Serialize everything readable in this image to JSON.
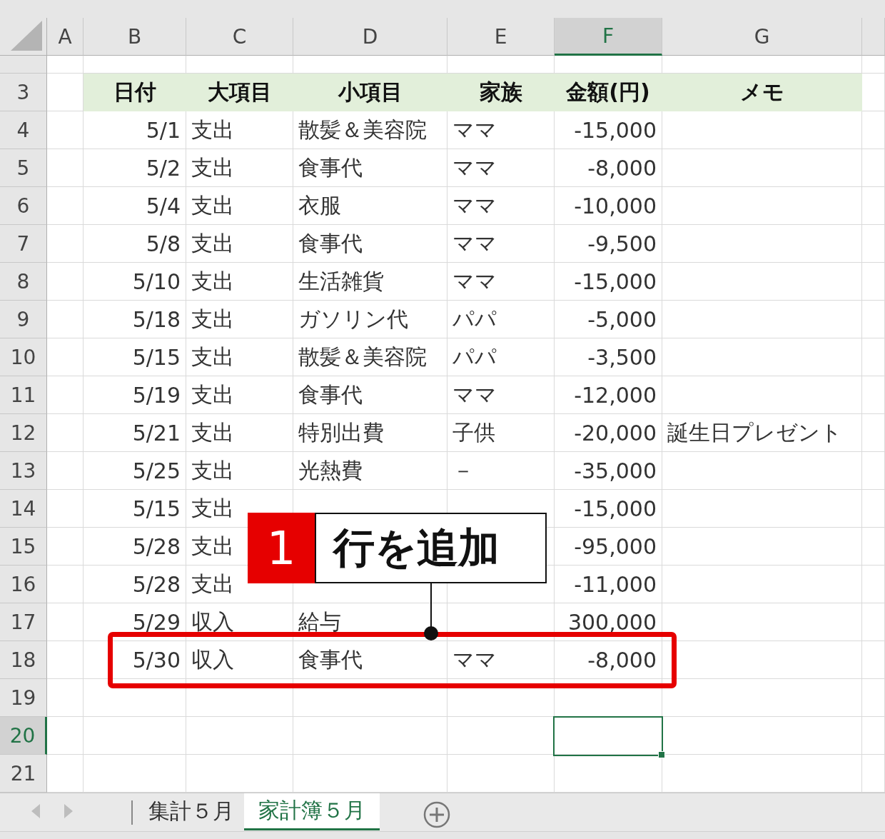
{
  "columns": [
    {
      "label": "A",
      "selected": false
    },
    {
      "label": "B",
      "selected": false
    },
    {
      "label": "C",
      "selected": false
    },
    {
      "label": "D",
      "selected": false
    },
    {
      "label": "E",
      "selected": false
    },
    {
      "label": "F",
      "selected": true
    },
    {
      "label": "G",
      "selected": false
    }
  ],
  "rows": [
    {
      "selected": false,
      "kind": "data",
      "cells": [
        null,
        null,
        null,
        null,
        null,
        null,
        null
      ]
    },
    {
      "number": "3",
      "selected": false,
      "kind": "header",
      "cells": [
        null,
        "日付",
        "大項目",
        "小項目",
        "家族",
        "金額(円)",
        "メモ"
      ]
    },
    {
      "number": "4",
      "selected": false,
      "kind": "data",
      "cells": [
        null,
        "5/1",
        "支出",
        "散髪＆美容院",
        "ママ",
        "-15,000",
        null
      ]
    },
    {
      "number": "5",
      "selected": false,
      "kind": "data",
      "cells": [
        null,
        "5/2",
        "支出",
        "食事代",
        "ママ",
        "-8,000",
        null
      ]
    },
    {
      "number": "6",
      "selected": false,
      "kind": "data",
      "cells": [
        null,
        "5/4",
        "支出",
        "衣服",
        "ママ",
        "-10,000",
        null
      ]
    },
    {
      "number": "7",
      "selected": false,
      "kind": "data",
      "cells": [
        null,
        "5/8",
        "支出",
        "食事代",
        "ママ",
        "-9,500",
        null
      ]
    },
    {
      "number": "8",
      "selected": false,
      "kind": "data",
      "cells": [
        null,
        "5/10",
        "支出",
        "生活雑貨",
        "ママ",
        "-15,000",
        null
      ]
    },
    {
      "number": "9",
      "selected": false,
      "kind": "data",
      "cells": [
        null,
        "5/18",
        "支出",
        "ガソリン代",
        "パパ",
        "-5,000",
        null
      ]
    },
    {
      "number": "10",
      "selected": false,
      "kind": "data",
      "cells": [
        null,
        "5/15",
        "支出",
        "散髪＆美容院",
        "パパ",
        "-3,500",
        null
      ]
    },
    {
      "number": "11",
      "selected": false,
      "kind": "data",
      "cells": [
        null,
        "5/19",
        "支出",
        "食事代",
        "ママ",
        "-12,000",
        null
      ]
    },
    {
      "number": "12",
      "selected": false,
      "kind": "data",
      "cells": [
        null,
        "5/21",
        "支出",
        "特別出費",
        "子供",
        "-20,000",
        "誕生日プレゼント"
      ]
    },
    {
      "number": "13",
      "selected": false,
      "kind": "data",
      "cells": [
        null,
        "5/25",
        "支出",
        "光熱費",
        "－",
        "-35,000",
        null
      ]
    },
    {
      "number": "14",
      "selected": false,
      "kind": "data",
      "cells": [
        null,
        "5/15",
        "支出",
        null,
        null,
        "-15,000",
        null
      ]
    },
    {
      "number": "15",
      "selected": false,
      "kind": "data",
      "cells": [
        null,
        "5/28",
        "支出",
        null,
        null,
        "-95,000",
        null
      ]
    },
    {
      "number": "16",
      "selected": false,
      "kind": "data",
      "cells": [
        null,
        "5/28",
        "支出",
        null,
        null,
        "-11,000",
        null
      ]
    },
    {
      "number": "17",
      "selected": false,
      "kind": "data",
      "cells": [
        null,
        "5/29",
        "収入",
        "給与",
        null,
        "300,000",
        null
      ]
    },
    {
      "number": "18",
      "selected": false,
      "kind": "data",
      "highlighted": true,
      "cells": [
        null,
        "5/30",
        "収入",
        "食事代",
        "ママ",
        "-8,000",
        null
      ]
    },
    {
      "number": "19",
      "selected": false,
      "kind": "data",
      "cells": [
        null,
        null,
        null,
        null,
        null,
        null,
        null
      ]
    },
    {
      "number": "20",
      "selected": true,
      "kind": "data",
      "cells": [
        null,
        null,
        null,
        null,
        null,
        null,
        null
      ]
    },
    {
      "number": "21",
      "selected": false,
      "kind": "data",
      "cells": [
        null,
        null,
        null,
        null,
        null,
        null,
        null
      ]
    }
  ],
  "callout": {
    "number": "1",
    "text": "行を追加"
  },
  "sheet_tabs": [
    {
      "label": "集計５月",
      "selected": false
    },
    {
      "label": "家計簿５月",
      "selected": true
    }
  ]
}
